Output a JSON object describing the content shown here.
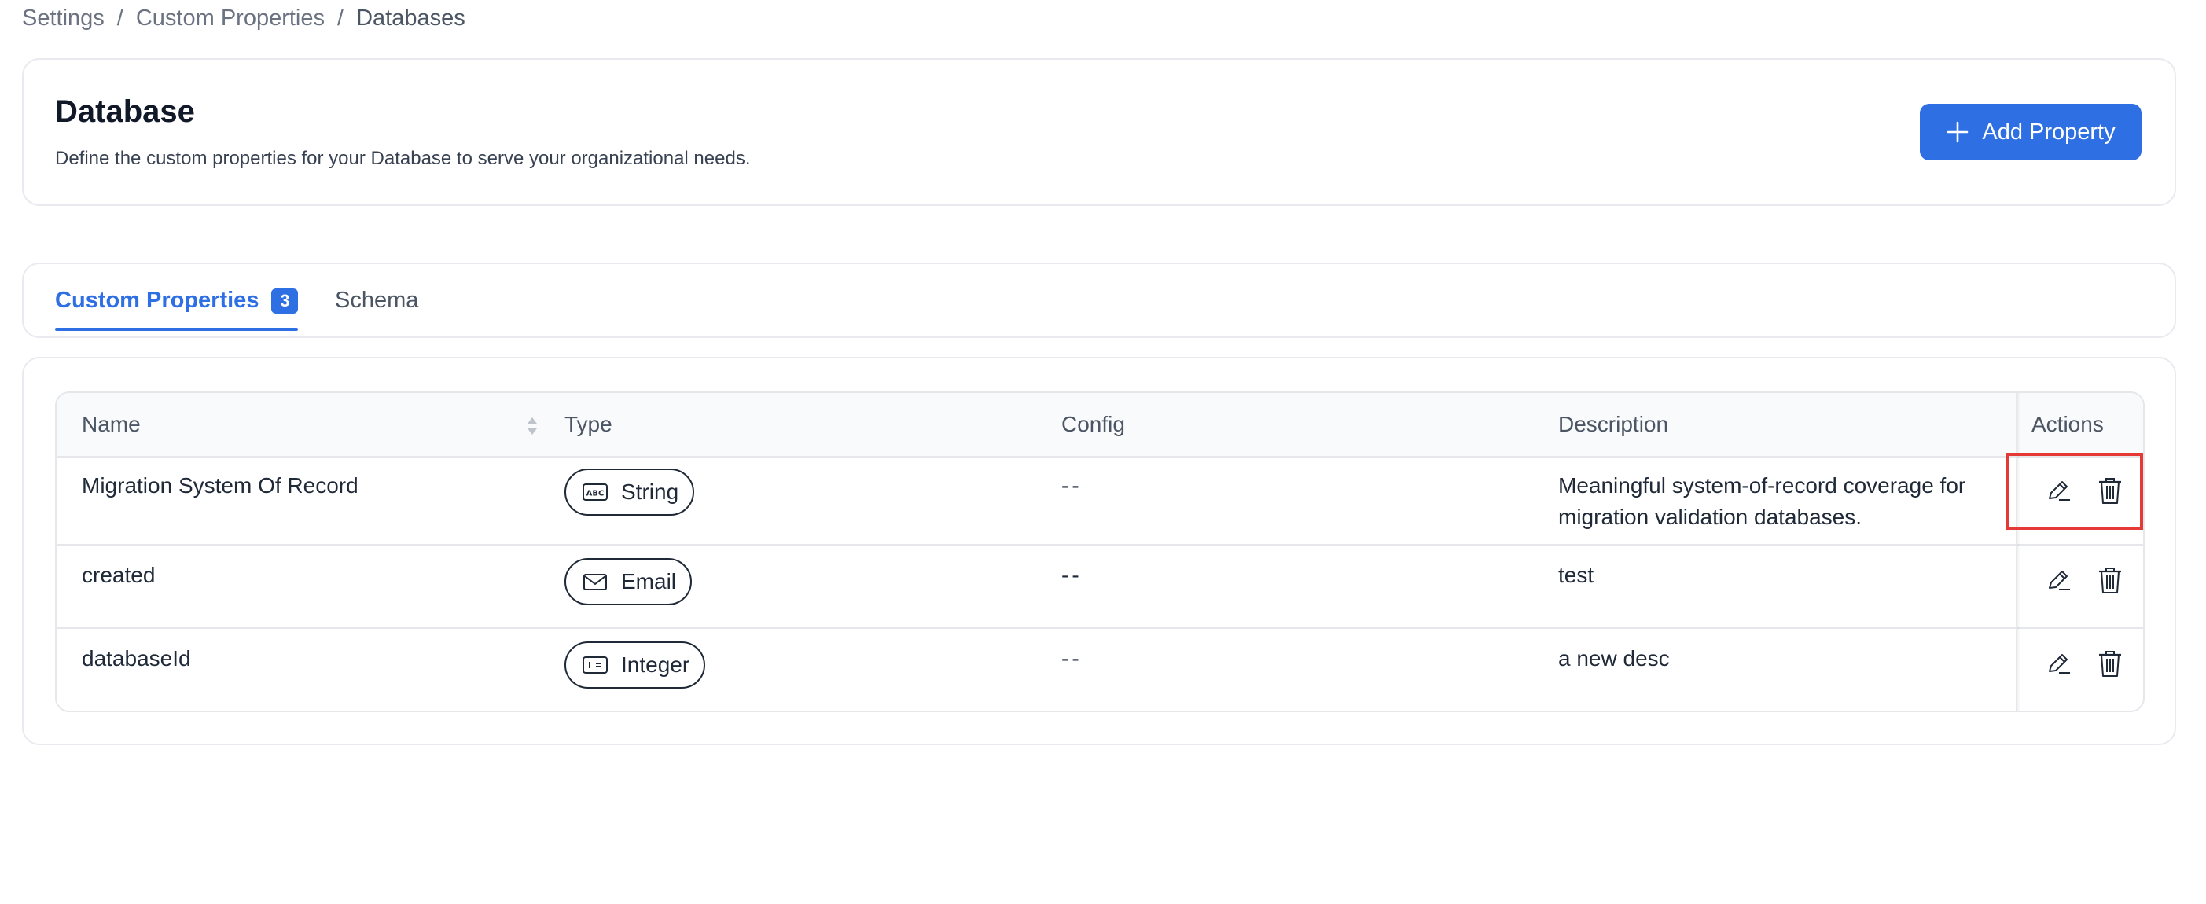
{
  "breadcrumb": {
    "items": [
      "Settings",
      "Custom Properties",
      "Databases"
    ],
    "separator": "/"
  },
  "header": {
    "title": "Database",
    "description": "Define the custom properties for your Database to serve your organizational needs.",
    "add_button_label": "Add Property",
    "add_button_icon": "plus-icon"
  },
  "tabs": [
    {
      "label": "Custom Properties",
      "badge": "3",
      "active": true
    },
    {
      "label": "Schema",
      "active": false
    }
  ],
  "table": {
    "columns": [
      "Name",
      "Type",
      "Config",
      "Description",
      "Actions"
    ],
    "rows": [
      {
        "name": "Migration System Of Record",
        "type": "String",
        "type_icon": "abc-text-icon",
        "config": "--",
        "description": "Meaningful system-of-record coverage for migration validation databases."
      },
      {
        "name": "created",
        "type": "Email",
        "type_icon": "envelope-icon",
        "config": "--",
        "description": "test"
      },
      {
        "name": "databaseId",
        "type": "Integer",
        "type_icon": "number-input-icon",
        "config": "--",
        "description": "a new desc"
      }
    ],
    "action_icons": [
      "edit-icon",
      "trash-icon"
    ]
  },
  "colors": {
    "accent": "#2f6fe4",
    "highlight": "#e53935"
  }
}
